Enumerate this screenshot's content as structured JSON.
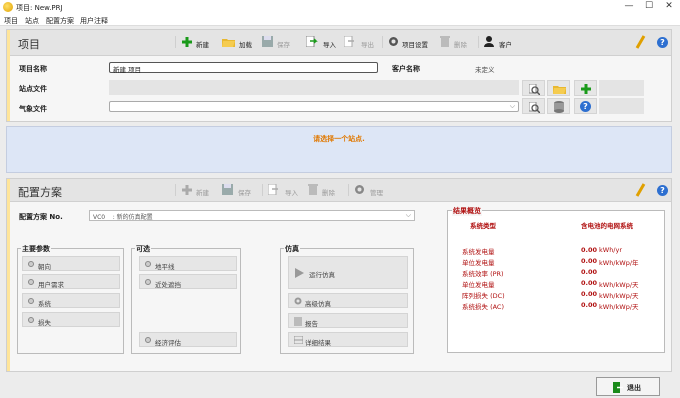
{
  "window": {
    "title": "项目: New.PRJ",
    "min": "—",
    "max": "☐",
    "close": "✕"
  },
  "menu": [
    "项目",
    "站点",
    "配置方案",
    "用户注释"
  ],
  "project_panel": {
    "title": "项目",
    "toolbar": {
      "new": "新建",
      "load": "加载",
      "save": "保存",
      "import": "导入",
      "export": "导出",
      "settings": "项目设置",
      "delete": "删除",
      "client": "客户"
    },
    "project_name_label": "项目名称",
    "project_name_value": "新建 项目",
    "client_name_label": "客户名称",
    "client_name_value": "未定义",
    "site_file_label": "站点文件",
    "weather_file_label": "气象文件"
  },
  "site_panel": {
    "message": "请选择一个站点."
  },
  "config_panel": {
    "title": "配置方案",
    "toolbar": {
      "new": "新建",
      "save": "保存",
      "import": "导入",
      "delete": "删除",
      "manage": "管理"
    },
    "config_label": "配置方案 No.",
    "config_value": "VC0    : 新的仿真配置",
    "main_params": {
      "title": "主要参数",
      "items": [
        "朝向",
        "用户需求",
        "系统",
        "损失"
      ]
    },
    "optional": {
      "title": "可选",
      "items": [
        "地平线",
        "近处遮挡",
        "经济评估"
      ]
    },
    "simulation": {
      "title": "仿真",
      "run": "运行仿真",
      "advanced": "高级仿真",
      "report": "报告",
      "detail": "详细结果"
    },
    "results": {
      "title": "结果概览",
      "col1": "系统类型",
      "col2": "含电池的电网系统",
      "rows": [
        {
          "label": "系统发电量",
          "value": "0.00",
          "unit": "kWh/yr"
        },
        {
          "label": "单位发电量",
          "value": "0.00",
          "unit": "kWh/kWp/年"
        },
        {
          "label": "系统效率 (PR)",
          "value": "0.00",
          "unit": ""
        },
        {
          "label": "单位发电量",
          "value": "0.00",
          "unit": "kWh/kWp/天"
        },
        {
          "label": "阵列损失 (DC)",
          "value": "0.00",
          "unit": "kWh/kWp/天"
        },
        {
          "label": "系统损失 (AC)",
          "value": "0.00",
          "unit": "kWh/kWp/天"
        }
      ]
    }
  },
  "exit_label": "退出",
  "colors": {
    "accent": "#2d6fd0",
    "warning": "#e07800",
    "result_red": "#b01010",
    "panel_left": "#ffe59a"
  }
}
